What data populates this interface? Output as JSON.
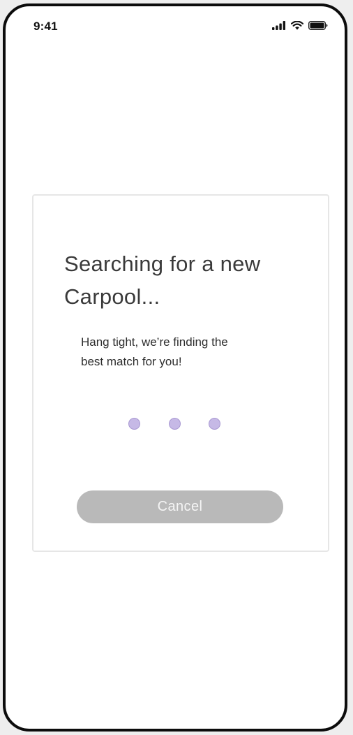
{
  "status_bar": {
    "time": "9:41",
    "icons": [
      "cellular-signal-icon",
      "wifi-icon",
      "battery-icon"
    ]
  },
  "dialog": {
    "title_line1": "Searching for a new",
    "title_line2": "Carpool...",
    "subtitle_line1": "Hang tight, we’re finding the",
    "subtitle_line2": "best match for you!",
    "loading_indicator": {
      "dot_count": 3,
      "dot_color": "#c6b9e6"
    },
    "cancel_label": "Cancel"
  },
  "colors": {
    "frame": "#0c0c0c",
    "button_bg": "#b9b9b9",
    "button_text": "#f5f5f5",
    "title_text": "#3a3a3a"
  }
}
